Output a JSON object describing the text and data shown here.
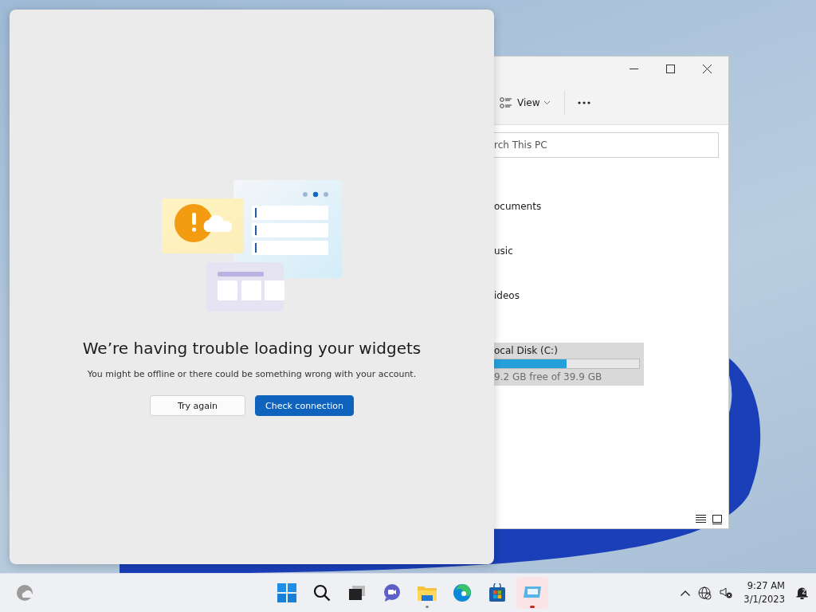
{
  "widgets_panel": {
    "heading": "We’re having trouble loading your widgets",
    "message": "You might be offline or there could be something wrong with your account.",
    "buttons": [
      {
        "label": "Try again",
        "kind": "secondary"
      },
      {
        "label": "Check connection",
        "kind": "primary"
      }
    ]
  },
  "explorer": {
    "view_label": "View",
    "search": {
      "placeholder": "rch This PC"
    },
    "items": [
      "ocuments",
      "usic",
      "ideos"
    ],
    "drive": {
      "name": "ocal Disk (C:)",
      "level": 0.5,
      "free": "9.2 GB free of 39.9 GB",
      "selected": true
    }
  },
  "taskbar": {
    "apps": [
      {
        "kind": "start",
        "running": false,
        "attention": false
      },
      {
        "kind": "search",
        "running": false,
        "attention": false
      },
      {
        "kind": "taskview",
        "running": false,
        "attention": false
      },
      {
        "kind": "chat",
        "running": false,
        "attention": false
      },
      {
        "kind": "files",
        "running": true,
        "attention": false
      },
      {
        "kind": "edge",
        "running": false,
        "attention": false
      },
      {
        "kind": "store",
        "running": false,
        "attention": false
      },
      {
        "kind": "remote",
        "running": true,
        "attention": true
      }
    ],
    "clock": {
      "time": "9:27 AM",
      "date": "3/1/2023"
    }
  }
}
